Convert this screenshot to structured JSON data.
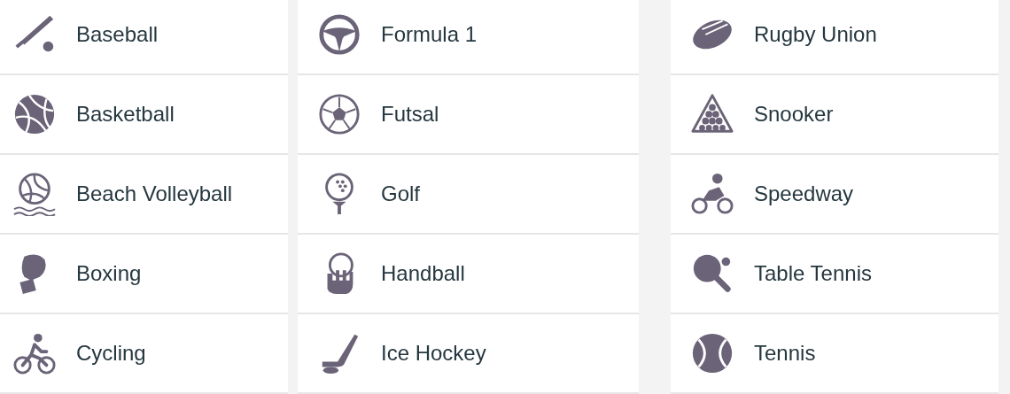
{
  "columns": [
    {
      "items": [
        {
          "label": "Baseball"
        },
        {
          "label": "Basketball"
        },
        {
          "label": "Beach Volleyball"
        },
        {
          "label": "Boxing"
        },
        {
          "label": "Cycling"
        }
      ]
    },
    {
      "items": [
        {
          "label": "Formula 1"
        },
        {
          "label": "Futsal"
        },
        {
          "label": "Golf"
        },
        {
          "label": "Handball"
        },
        {
          "label": "Ice Hockey"
        }
      ]
    },
    {
      "items": [
        {
          "label": "Rugby Union"
        },
        {
          "label": "Snooker"
        },
        {
          "label": "Speedway"
        },
        {
          "label": "Table Tennis"
        },
        {
          "label": "Tennis"
        }
      ]
    }
  ]
}
